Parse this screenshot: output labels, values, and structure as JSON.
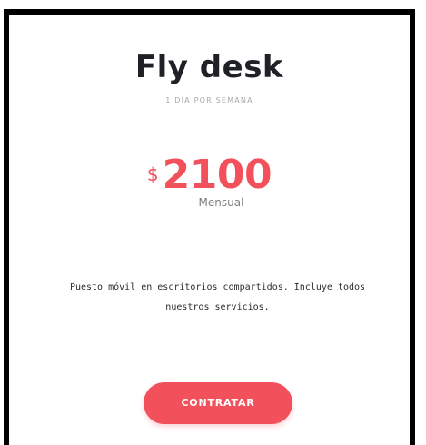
{
  "plan": {
    "name": "Fly desk",
    "frequency": "1 DÍA POR SEMANA",
    "currency_symbol": "$",
    "price": "2100",
    "period": "Mensual",
    "description": "Puesto móvil en escritorios compartidos. Incluye todos nuestros servicios.",
    "cta_label": "CONTRATAR"
  },
  "colors": {
    "accent": "#f2505a",
    "title": "#1f2127",
    "muted": "#a9a9a9",
    "frame": "#000000"
  }
}
